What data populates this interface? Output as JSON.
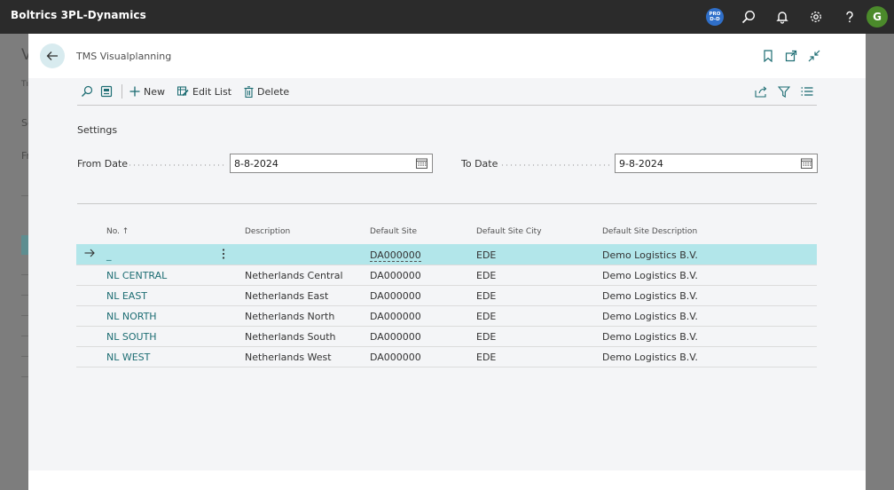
{
  "app": {
    "title": "Boltrics 3PL-Dynamics",
    "env_badge_line1": "PRO",
    "env_badge_line2": "D-D",
    "avatar_initial": "G"
  },
  "background_page": {
    "frag1": "V",
    "frag2": "Tı",
    "frag3": "Se",
    "frag4": "Fr"
  },
  "dialog": {
    "title": "TMS Visualplanning"
  },
  "actions": {
    "new_label": "New",
    "edit_list_label": "Edit List",
    "delete_label": "Delete"
  },
  "settings": {
    "section_title": "Settings",
    "from_date_label": "From Date",
    "from_date_value": "8-8-2024",
    "to_date_label": "To Date",
    "to_date_value": "9-8-2024"
  },
  "table": {
    "headers": {
      "no": "No. ↑",
      "description": "Description",
      "default_site": "Default Site",
      "default_site_city": "Default Site City",
      "default_site_description": "Default Site Description"
    },
    "rows": [
      {
        "no": "_",
        "description": "",
        "default_site": "DA000000",
        "default_site_city": "EDE",
        "default_site_description": "Demo Logistics B.V."
      },
      {
        "no": "NL CENTRAL",
        "description": "Netherlands Central",
        "default_site": "DA000000",
        "default_site_city": "EDE",
        "default_site_description": "Demo Logistics B.V."
      },
      {
        "no": "NL EAST",
        "description": "Netherlands East",
        "default_site": "DA000000",
        "default_site_city": "EDE",
        "default_site_description": "Demo Logistics B.V."
      },
      {
        "no": "NL NORTH",
        "description": "Netherlands North",
        "default_site": "DA000000",
        "default_site_city": "EDE",
        "default_site_description": "Demo Logistics B.V."
      },
      {
        "no": "NL SOUTH",
        "description": "Netherlands South",
        "default_site": "DA000000",
        "default_site_city": "EDE",
        "default_site_description": "Demo Logistics B.V."
      },
      {
        "no": "NL WEST",
        "description": "Netherlands West",
        "default_site": "DA000000",
        "default_site_city": "EDE",
        "default_site_description": "Demo Logistics B.V."
      }
    ]
  },
  "colors": {
    "topbar": "#2b2b2b",
    "accent_link": "#1d6d73",
    "selected_row": "#b2e6ea",
    "env_badge": "#2f6fc9",
    "avatar": "#4b8a2b"
  }
}
